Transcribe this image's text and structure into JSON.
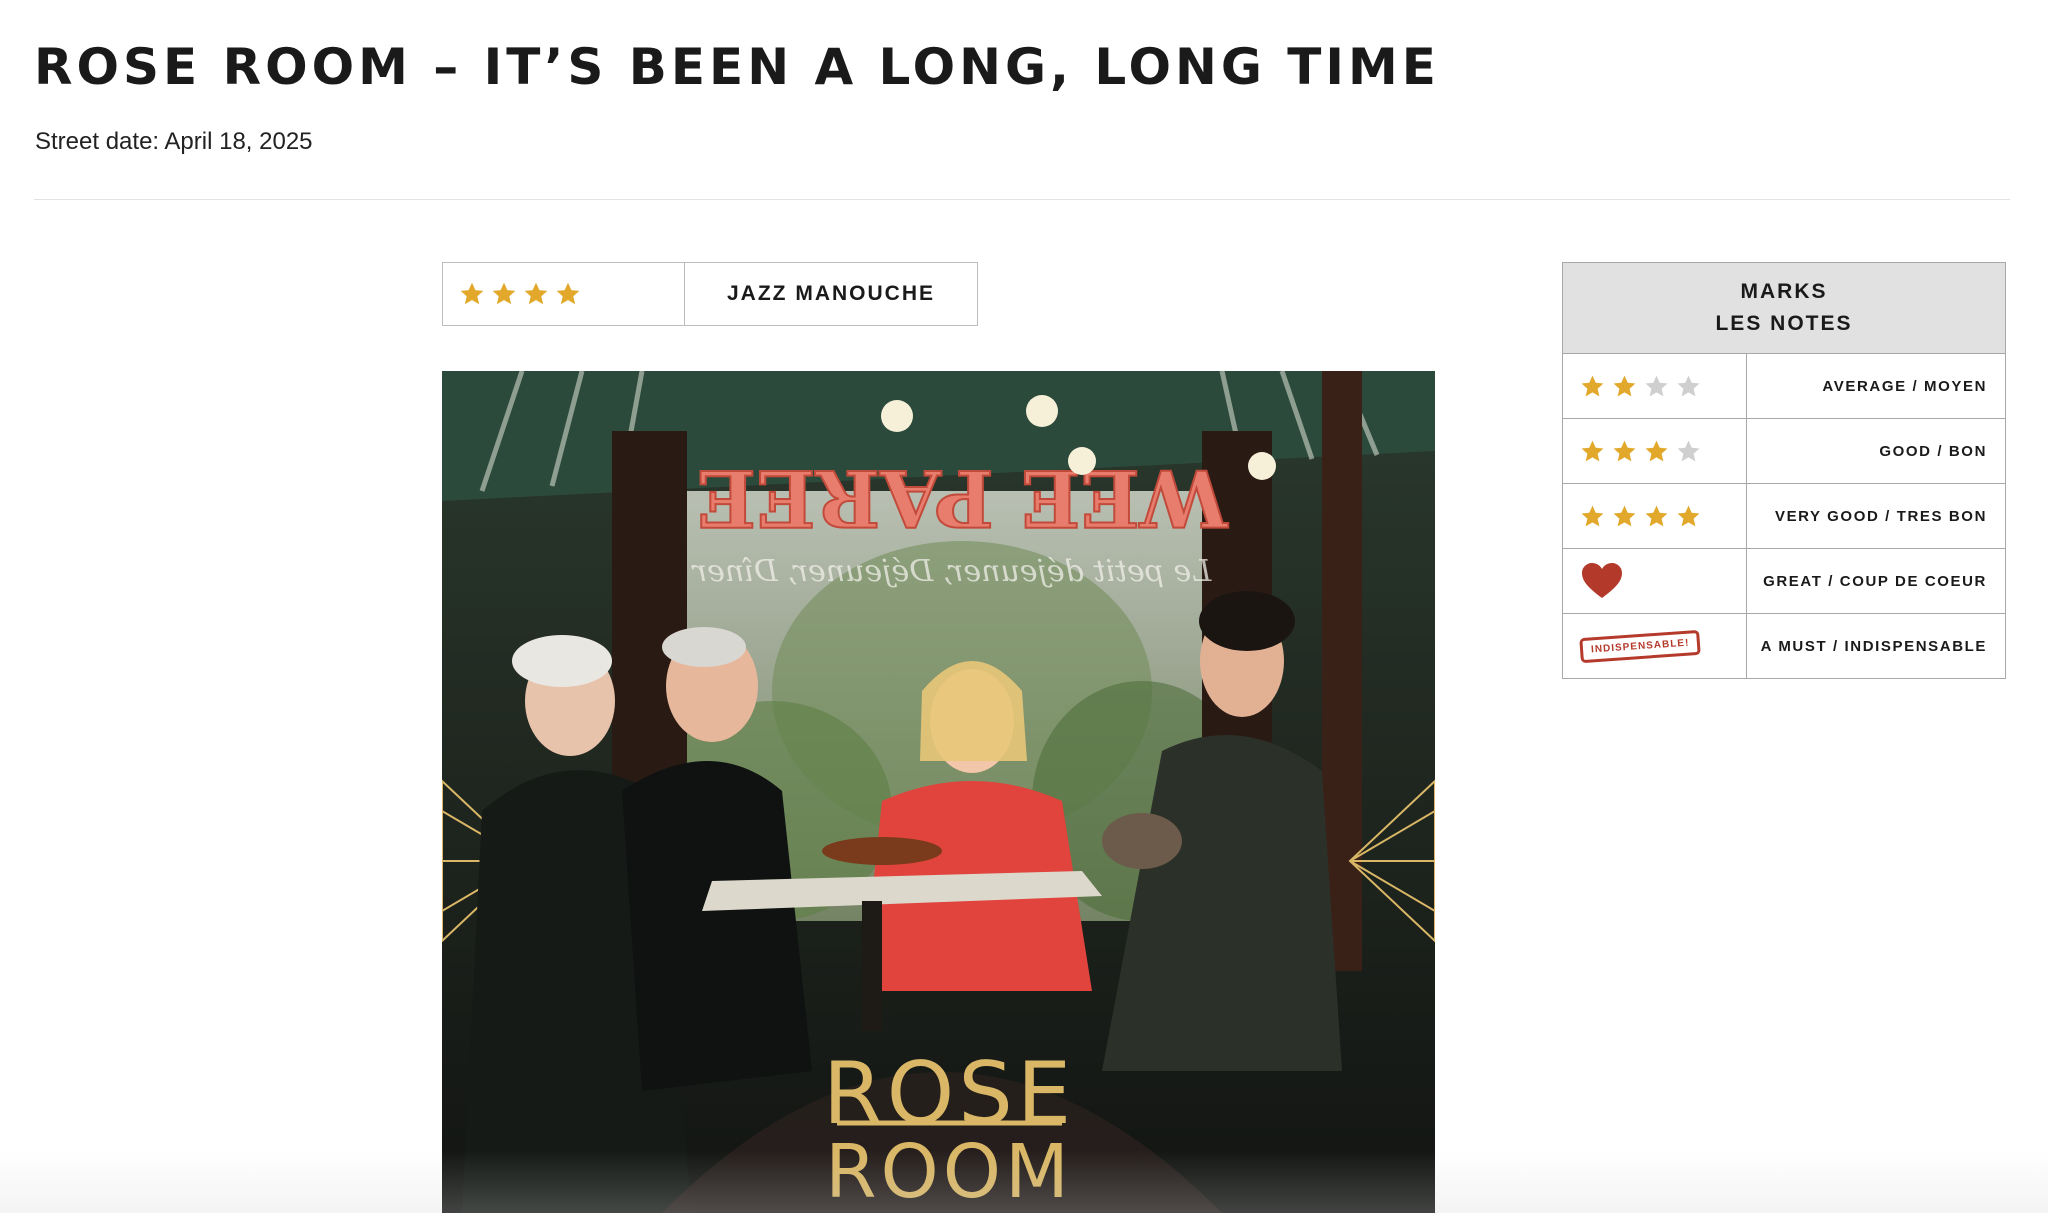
{
  "page": {
    "title": "ROSE ROOM – IT’S BEEN A LONG, LONG TIME",
    "street_date": "Street date: April 18, 2025"
  },
  "review": {
    "rating_stars": 4,
    "rating_max": 4,
    "genre": "JAZZ MANOUCHE"
  },
  "cover": {
    "sign_text": "WEE PAREE",
    "window_script": "Le petit déjeuner, Déjeuner, Dîner",
    "logo_line1": "ROSE",
    "logo_line2": "ROOM"
  },
  "legend": {
    "header_line1": "MARKS",
    "header_line2": "LES NOTES",
    "rows": [
      {
        "stars_on": 2,
        "stars_total": 4,
        "label": "AVERAGE / MOYEN"
      },
      {
        "stars_on": 3,
        "stars_total": 4,
        "label": "GOOD / BON"
      },
      {
        "stars_on": 4,
        "stars_total": 4,
        "label": "VERY GOOD / TRES BON"
      },
      {
        "icon": "heart-icon",
        "label": "GREAT / COUP DE COEUR"
      },
      {
        "icon": "stamp-icon",
        "stamp_text": "INDISPENSABLE!",
        "label": "A MUST / INDISPENSABLE"
      }
    ]
  },
  "colors": {
    "star_gold": "#e2a82c",
    "star_grey": "#cfcfcf",
    "heart_red": "#b33a2a",
    "stamp_red": "#b53a2b",
    "legend_header_bg": "#e1e1e1",
    "logo_gold": "#d9b766"
  }
}
